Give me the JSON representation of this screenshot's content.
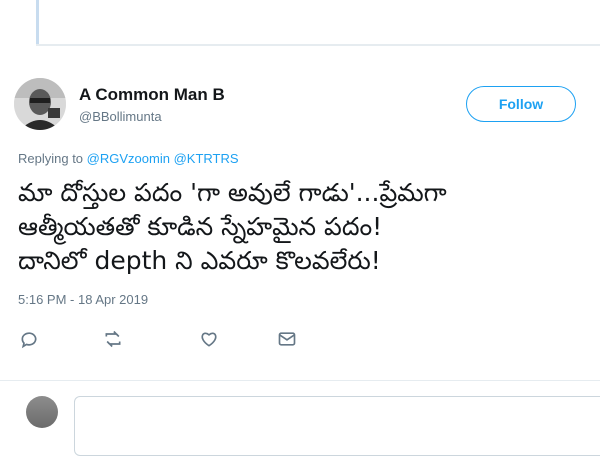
{
  "user": {
    "display_name": "A Common Man B",
    "handle": "@BBollimunta"
  },
  "follow_button": {
    "label": "Follow"
  },
  "reply_context": {
    "prefix": "Replying to",
    "mentions": [
      "@RGVzoomin",
      "@KTRTRS"
    ]
  },
  "tweet": {
    "lines": [
      "మా దోస్తుల పదం 'గా అవులే గాడు'...ప్రేమగా",
      "ఆత్మీయతతో కూడిన స్నేహమైన పదం!",
      "దానిలో depth ని ఎవరూ కొలవలేరు!"
    ],
    "timestamp": "5:16 PM - 18 Apr 2019"
  },
  "actions": [
    {
      "icon": "reply-icon"
    },
    {
      "icon": "retweet-icon"
    },
    {
      "icon": "like-icon"
    },
    {
      "icon": "message-icon"
    }
  ],
  "colors": {
    "accent": "#1da1f2",
    "secondary_text": "#657786",
    "primary_text": "#14171a",
    "divider": "#e6ecf0"
  }
}
